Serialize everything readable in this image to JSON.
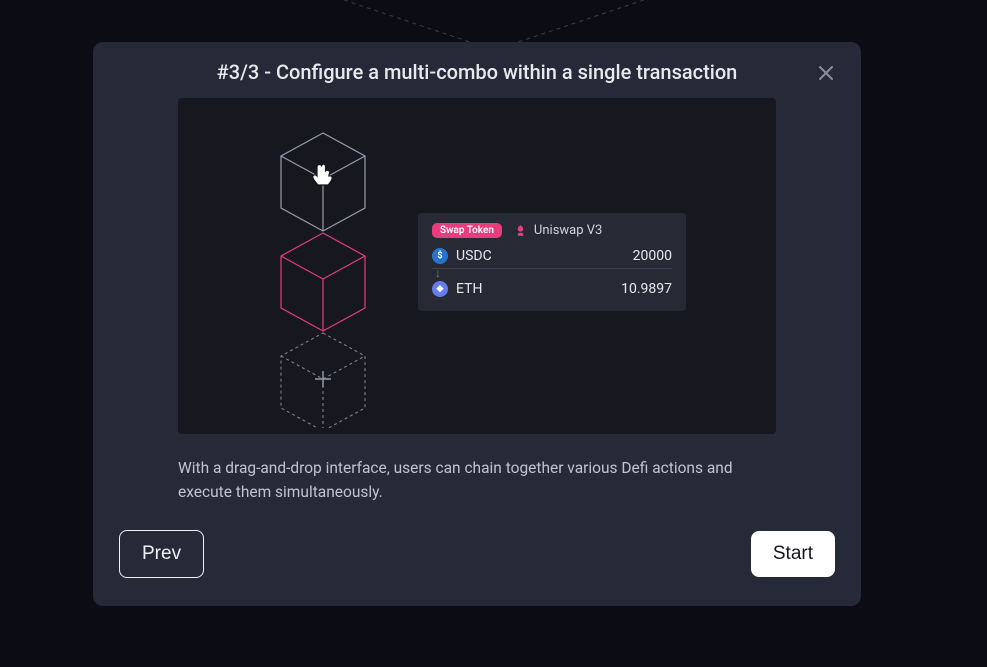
{
  "modal": {
    "title": "#3/3 - Configure a multi-combo within a single transaction",
    "description": "With a drag-and-drop interface, users can chain together various Defi actions and execute them simultaneously."
  },
  "swap": {
    "badge": "Swap Token",
    "protocol": "Uniswap V3",
    "from": {
      "symbol": "USDC",
      "amount": "20000"
    },
    "to": {
      "symbol": "ETH",
      "amount": "10.9897"
    }
  },
  "footer": {
    "prev": "Prev",
    "start": "Start"
  }
}
